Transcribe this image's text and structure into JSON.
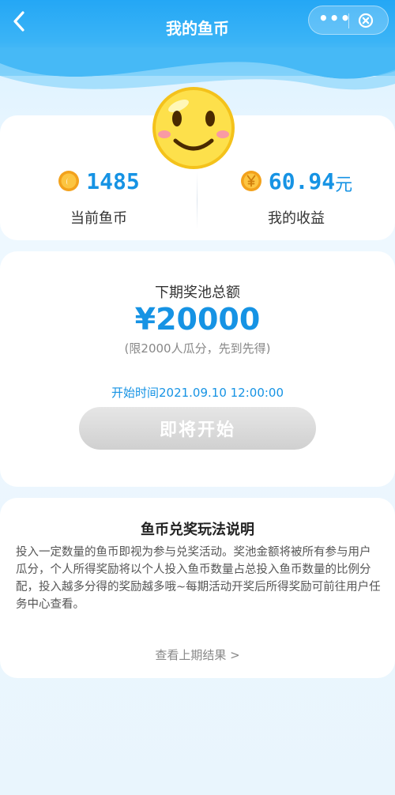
{
  "header": {
    "title": "我的鱼币"
  },
  "stats": {
    "coins_value": "1485",
    "coins_label": "当前鱼币",
    "earnings_value": "60.94",
    "earnings_unit": "元",
    "earnings_label": "我的收益"
  },
  "pool": {
    "title": "下期奖池总额",
    "amount": "¥20000",
    "limit": "(限2000人瓜分，先到先得)",
    "start_time": "开始时间2021.09.10 12:00:00",
    "button_label": "即将开始"
  },
  "rules": {
    "title": "鱼币兑奖玩法说明",
    "text": "投入一定数量的鱼币即视为参与兑奖活动。奖池金额将被所有参与用户瓜分，个人所得奖励将以个人投入鱼币数量占总投入鱼币数量的比例分配，投入越多分得的奖励越多哦~每期活动开奖后所得奖励可前往用户任务中心查看。",
    "history_link": "查看上期结果 >"
  },
  "icons": {
    "back": "chevron-left-icon",
    "more": "more-dots-icon",
    "close": "close-circle-icon",
    "mascot": "smiley-face-icon",
    "coin": "gold-coin-icon",
    "yuan_coin": "yuan-coin-icon"
  },
  "colors": {
    "accent": "#1693e4",
    "header": "#24a7f5",
    "button_disabled": "#d6d6d6"
  }
}
